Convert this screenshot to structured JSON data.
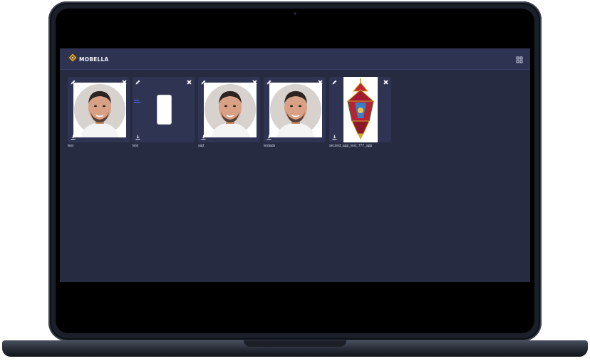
{
  "app": {
    "brand": "MOBELLA"
  },
  "apps": [
    {
      "label": "test",
      "thumbnail": "portrait-photo"
    },
    {
      "label": "test",
      "thumbnail": "phone-mockup"
    },
    {
      "label": "sad",
      "thumbnail": "portrait-photo"
    },
    {
      "label": "testads",
      "thumbnail": "portrait-photo"
    },
    {
      "label": "second_app_test_777_app",
      "thumbnail": "lantern-image"
    }
  ],
  "icons": {
    "edit": "pencil-icon",
    "delete": "close-icon",
    "download": "download-icon",
    "layout": "grid-icon"
  },
  "colors": {
    "screen_bg": "#272b42",
    "topbar_bg": "#2e3352",
    "card_bg": "#2f3452",
    "logo_accent": "#f2a900"
  }
}
